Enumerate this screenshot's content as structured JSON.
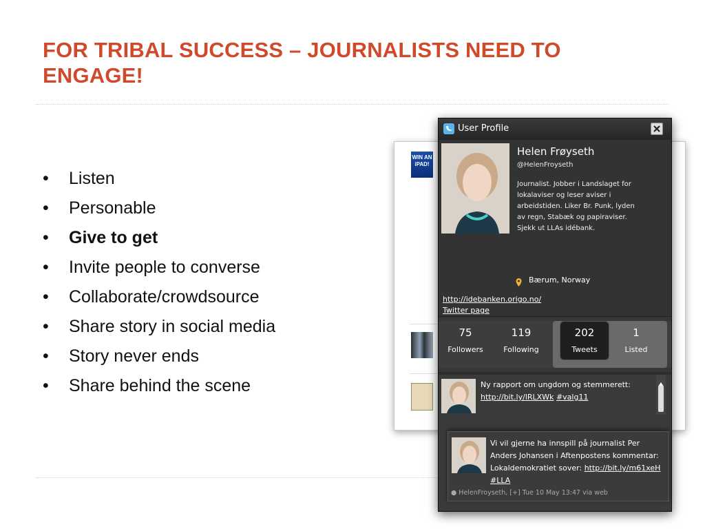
{
  "slide": {
    "title": "FOR TRIBAL SUCCESS – JOURNALISTS NEED TO ENGAGE!",
    "bullets": [
      {
        "text": "Listen",
        "bold": false
      },
      {
        "text": "Personable",
        "bold": false
      },
      {
        "text": "Give to get",
        "bold": true
      },
      {
        "text": "Invite people to converse",
        "bold": false
      },
      {
        "text": "Collaborate/crowdsource",
        "bold": false
      },
      {
        "text": "Share story in social media",
        "bold": false
      },
      {
        "text": "Story never ends",
        "bold": false
      },
      {
        "text": "Share behind the scene",
        "bold": false
      }
    ],
    "bullet_char": "•",
    "title_color": "#cf4a2a"
  },
  "background_page": {
    "ipad_thumb_text": "WIN AN iPAD!"
  },
  "popup": {
    "window_title": "User Profile",
    "icons": {
      "title_icon": "twitter-bird-icon",
      "close": "close-icon",
      "location": "location-pin-icon",
      "expand": "expand-arrow-icon"
    },
    "profile": {
      "name": "Helen Frøyseth",
      "handle": "@HelenFroyseth",
      "bio": "Journalist. Jobber i Landslaget for lokalaviser og leser aviser i arbeidstiden. Liker Br. Punk, lyden av regn, Stabæk og papiraviser. Sjekk ut LLAs idébank.",
      "location": "Bærum, Norway",
      "website": "http://idebanken.origo.no/",
      "twitter_page": "Twitter page"
    },
    "stats": [
      {
        "num": "75",
        "label": "Followers"
      },
      {
        "num": "119",
        "label": "Following"
      },
      {
        "num": "202",
        "label": "Tweets",
        "selected": true
      },
      {
        "num": "1",
        "label": "Listed"
      }
    ],
    "tweets": [
      {
        "text": "Ny rapport om ungdom og stemmerett:",
        "link": "http://bit.ly/lRLXWk",
        "hashtag": "#valg11"
      }
    ],
    "tweet_popout": {
      "text": "Vi vil gjerne ha innspill på journalist Per Anders Johansen i Aftenpostens kommentar: Lokaldemokratiet sover:",
      "link": "http://bit.ly/m61xeH",
      "hashtag": "#LLA",
      "meta": "● HelenFroyseth, [+] Tue 10 May 13:47 via web"
    }
  }
}
